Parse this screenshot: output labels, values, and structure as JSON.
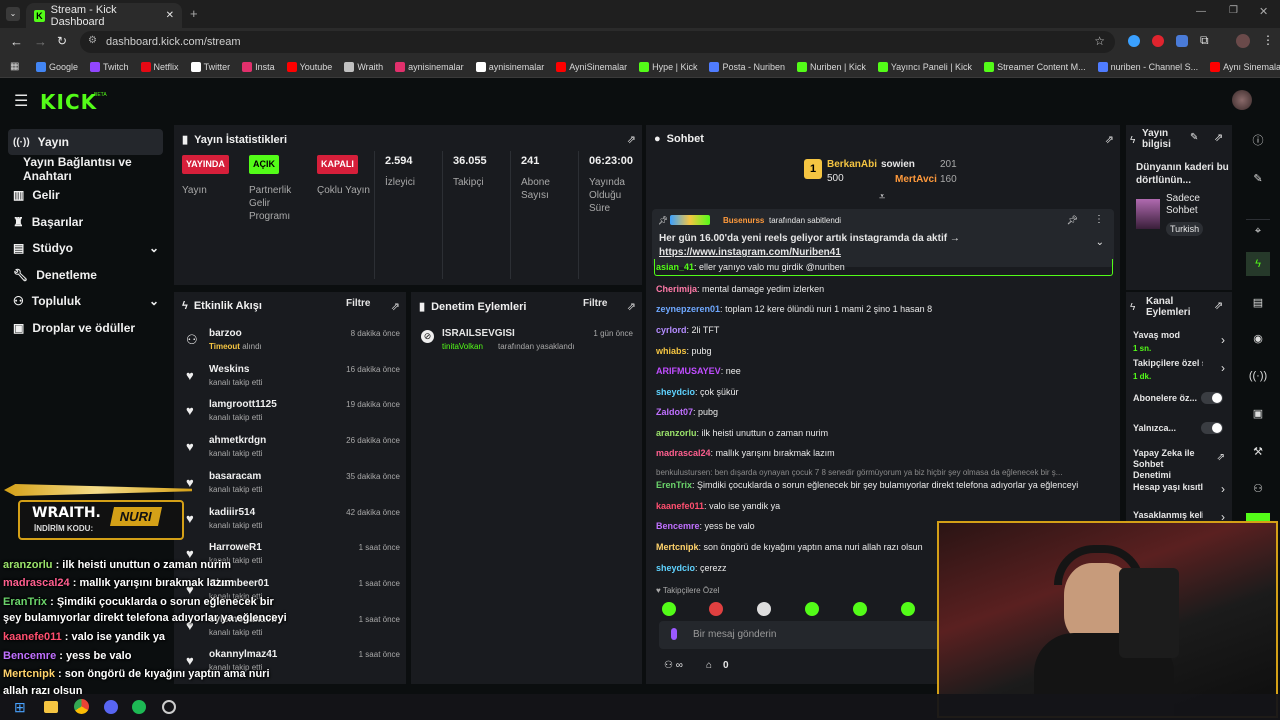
{
  "browser": {
    "tab_title": "Stream - Kick Dashboard",
    "url": "dashboard.kick.com/stream",
    "bookmarks": [
      "Google",
      "Twitch",
      "Netflix",
      "Twitter",
      "Insta",
      "Youtube",
      "Wraith",
      "aynisinemalar",
      "aynisinemalar",
      "AyniSinemalar",
      "Hype | Kick",
      "Posta - Nuriben",
      "Nuriben | Kick",
      "Yayıncı Paneli | Kick",
      "Streamer Content M...",
      "nuriben - Channel S...",
      "Aynı Sinemalar - Ça..."
    ],
    "bookmark_colors": [
      "#4285f4",
      "#9146ff",
      "#e50914",
      "#ffffff",
      "#e1306c",
      "#ff0000",
      "#c0c0c0",
      "#e1306c",
      "#ffffff",
      "#ff0000",
      "#53fc18",
      "#4f7cff",
      "#53fc18",
      "#53fc18",
      "#53fc18",
      "#4f7cff",
      "#ff0000"
    ]
  },
  "brand": {
    "logo": "KICK",
    "beta": "BETA"
  },
  "sidebar": {
    "items": [
      {
        "label": "Yayın",
        "icon": "broadcast-icon"
      },
      {
        "label": "Yayın Bağlantısı ve Anahtarı",
        "icon": ""
      },
      {
        "label": "Gelir",
        "icon": "chart-icon"
      },
      {
        "label": "Başarılar",
        "icon": "trophy-icon"
      },
      {
        "label": "Stüdyo",
        "icon": "studio-icon"
      },
      {
        "label": "Denetleme",
        "icon": "wrench-icon"
      },
      {
        "label": "Topluluk",
        "icon": "community-icon"
      },
      {
        "label": "Droplar ve ödüller",
        "icon": "gift-icon"
      }
    ]
  },
  "stats": {
    "title": "Yayın İstatistikleri",
    "badges": [
      {
        "badge": "YAYINDA",
        "label": "Yayın",
        "color": "#d61f3a"
      },
      {
        "badge": "AÇIK",
        "label": "Partnerlik Gelir Programı",
        "color": "#53fc18"
      },
      {
        "badge": "KAPALI",
        "label": "Çoklu Yayın",
        "color": "#d61f3a"
      }
    ],
    "numbers": [
      {
        "value": "2.594",
        "label": "İzleyici"
      },
      {
        "value": "36.055",
        "label": "Takipçi"
      },
      {
        "value": "241",
        "label": "Abone Sayısı"
      },
      {
        "value": "06:23:00",
        "label": "Yayında Olduğu Süre"
      }
    ]
  },
  "activity": {
    "title": "Etkinlik Akışı",
    "filter": "Filtre",
    "rows": [
      {
        "name": "barzoo",
        "sub_highlight": "Timeout",
        "sub": "alındı",
        "time": "8 dakika önce"
      },
      {
        "name": "Weskins",
        "sub_highlight": "",
        "sub": "kanalı takip etti",
        "time": "16 dakika önce"
      },
      {
        "name": "lamgroott1125",
        "sub_highlight": "",
        "sub": "kanalı takip etti",
        "time": "19 dakika önce"
      },
      {
        "name": "ahmetkrdgn",
        "sub_highlight": "",
        "sub": "kanalı takip etti",
        "time": "26 dakika önce"
      },
      {
        "name": "basaracam",
        "sub_highlight": "",
        "sub": "kanalı takip etti",
        "time": "35 dakika önce"
      },
      {
        "name": "kadiiir514",
        "sub_highlight": "",
        "sub": "kanalı takip etti",
        "time": "42 dakika önce"
      },
      {
        "name": "HarroweR1",
        "sub_highlight": "",
        "sub": "kanalı takip etti",
        "time": "1 saat önce"
      },
      {
        "name": "Chambeer01",
        "sub_highlight": "",
        "sub": "kanalı takip etti",
        "time": "1 saat önce"
      },
      {
        "name": "eylemocakavir",
        "sub_highlight": "",
        "sub": "kanalı takip etti",
        "time": "1 saat önce"
      },
      {
        "name": "okannylmaz41",
        "sub_highlight": "",
        "sub": "kanalı takip etti",
        "time": "1 saat önce"
      }
    ]
  },
  "moderation": {
    "title": "Denetim Eylemleri",
    "filter": "Filtre",
    "rows": [
      {
        "name": "ISRAILSEVGISI",
        "actor": "tinitaVolkan",
        "action": "tarafından yasaklandı",
        "time": "1 gün önce"
      }
    ]
  },
  "chat": {
    "title": "Sohbet",
    "leaders": [
      {
        "name": "BerkanAbi",
        "amount": "500"
      },
      {
        "name": "sowien",
        "amount": "201"
      },
      {
        "name": "MertAvci",
        "amount": "160"
      }
    ],
    "pinned": {
      "by": "Busenurss",
      "by_suffix": "tarafından sabitlendi",
      "text": "Her gün 16.00'da yeni reels geliyor artık instagramda da aktif →",
      "link": "https://www.instagram.com/Nuriben41"
    },
    "messages": [
      {
        "user": "asian_41",
        "color": "#53fc18",
        "text": "eller yanıyo valo mu girdik @nuriben"
      },
      {
        "user": "Cherimija",
        "color": "#ff7aa8",
        "text": "mental damage yedim izlerken"
      },
      {
        "user": "zeynepzeren01",
        "color": "#6fa8ff",
        "text": "toplam 12 kere ölündü nuri 1 mami 2 şino 1 hasan 8"
      },
      {
        "user": "cyrlord",
        "color": "#b48cff",
        "text": "2li TFT"
      },
      {
        "user": "whiabs",
        "color": "#f5c542",
        "text": "pubg"
      },
      {
        "user": "ARIFMUSAYEV",
        "color": "#c04dff",
        "text": "nee"
      },
      {
        "user": "sheydcio",
        "color": "#5fd3ff",
        "text": "çok şükür"
      },
      {
        "user": "Zaldot07",
        "color": "#c070ff",
        "text": "pubg"
      },
      {
        "user": "aranzorlu",
        "color": "#9be36b",
        "text": "ilk heisti unuttun o zaman nurim"
      },
      {
        "user": "madrascal24",
        "color": "#ff5f8f",
        "text": "mallık yarışını bırakmak lazım"
      },
      {
        "user": "ErenTrix",
        "color": "#6bd46b",
        "text": "Şimdiki çocuklarda o sorun eğlenecek bir şey bulamıyorlar direkt telefona adıyorlar ya eğlenceyi"
      },
      {
        "user": "kaanefe011",
        "color": "#ff4f6f",
        "text": "valo ise yandik ya"
      },
      {
        "user": "Bencemre",
        "color": "#c070ff",
        "text": "yess be valo"
      },
      {
        "user": "Mertcnipk",
        "color": "#ffd36b",
        "text": "son öngörü de kıyağını yaptın ama nuri allah razı olsun"
      },
      {
        "user": "sheydcio",
        "color": "#5fd3ff",
        "text": "çerezz"
      }
    ],
    "reply": "benkulustursen: ben dışarda oynayan çocuk 7 8 senedir görmüyorum ya biz hiçbir şey olmasa da eğlenecek bir ş...",
    "followers_only": "Takipçilere Özel",
    "input_placeholder": "Bir mesaj gönderin",
    "count": "0"
  },
  "stream_info": {
    "title": "Yayın bilgisi",
    "description": "Dünyanın kaderi bu dörtlünün...",
    "category": "Sadece Sohbet",
    "language": "Turkish"
  },
  "channel_actions": {
    "title": "Kanal Eylemleri",
    "items": [
      {
        "label": "Yavaş mod",
        "sub": "1 sn."
      },
      {
        "label": "Takipçilere özel s",
        "sub": "1 dk."
      },
      {
        "label": "Abonelere öz...",
        "sub": ""
      },
      {
        "label": "Yalnızca...",
        "sub": ""
      },
      {
        "label": "Yapay Zeka ile Sohbet Denetimi",
        "sub": ""
      },
      {
        "label": "Hesap yaşı kısıtla",
        "sub": ""
      },
      {
        "label": "Yasaklanmış kelin",
        "sub": ""
      }
    ]
  },
  "overlay": {
    "promo_brand": "WRAITH.",
    "promo_code_label": "İNDİRİM KODU:",
    "promo_code": "NURI",
    "chat": [
      {
        "user": "aranzorlu",
        "color": "#9be36b",
        "text": ": ilk heisti unuttun o zaman nurim"
      },
      {
        "user": "madrascal24",
        "color": "#ff5f8f",
        "text": ": mallık yarışını bırakmak lazım"
      },
      {
        "user": "EranTrix",
        "color": "#6bd46b",
        "text": ": Şimdiki çocuklarda o sorun eğlenecek bir"
      },
      {
        "user": "",
        "color": "#ffffff",
        "text": "şey bulamıyorlar direkt telefona adıyorlar ya eğlenceyi"
      },
      {
        "user": "kaanefe011",
        "color": "#ff4f6f",
        "text": ": valo ise yandik ya"
      },
      {
        "user": "Bencemre",
        "color": "#c070ff",
        "text": ": yess be valo"
      },
      {
        "user": "Mertcnipk",
        "color": "#ffd36b",
        "text": ": son öngörü de kıyağını yaptın ama nuri"
      },
      {
        "user": "",
        "color": "#ffffff",
        "text": "allah razı olsun"
      }
    ]
  }
}
